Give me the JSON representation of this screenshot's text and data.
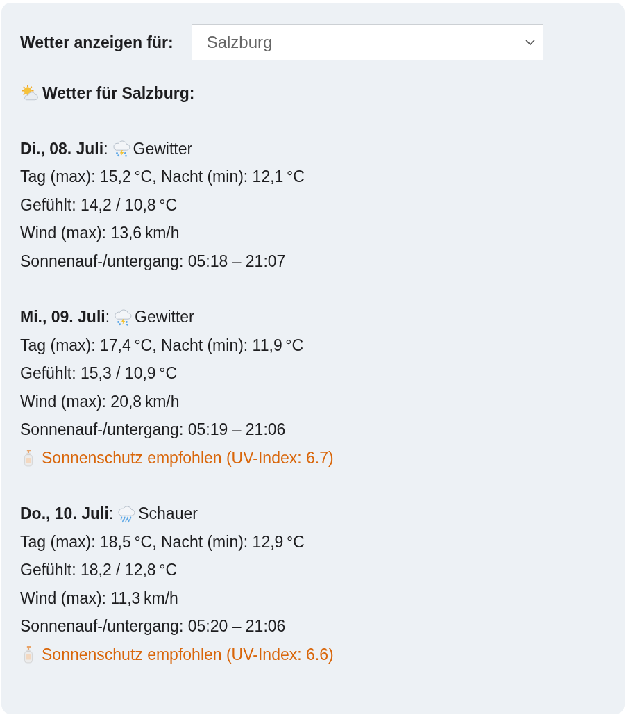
{
  "location_picker": {
    "label": "Wetter anzeigen für:",
    "value": "Salzburg"
  },
  "heading": "Wetter für Salzburg:",
  "days": [
    {
      "date": "**Di., 08. Juli**:",
      "kind": "thunderstorm",
      "condition": "Gewitter",
      "lines": [
        "Tag (max): 15,2 °C, Nacht (min): 12,1 °C",
        "Gefühlt: 14,2 / 10,8 °C",
        "Wind (max): 13,6 km/h",
        "Sonnenauf-/untergang: 05:18 – 21:07"
      ]
    },
    {
      "date": "**Mi., 09. Juli**:",
      "kind": "thunderstorm",
      "condition": "Gewitter",
      "lines": [
        "Tag (max): 17,4 °C, Nacht (min): 11,9 °C",
        "Gefühlt: 15,3 / 10,9 °C",
        "Wind (max): 20,8 km/h",
        "Sonnenauf-/untergang: 05:19 – 21:06"
      ],
      "warning": "Sonnenschutz empfohlen (UV-Index: 6.7)"
    },
    {
      "date": "**Do., 10. Juli**:",
      "kind": "rain",
      "condition": "Schauer",
      "lines": [
        "Tag (max): 18,5 °C, Nacht (min): 12,9 °C",
        "Gefühlt: 18,2 / 12,8 °C",
        "Wind (max): 11,3 km/h",
        "Sonnenauf-/untergang: 05:20 – 21:06"
      ],
      "warning": "Sonnenschutz empfohlen (UV-Index: 6.6)"
    }
  ]
}
